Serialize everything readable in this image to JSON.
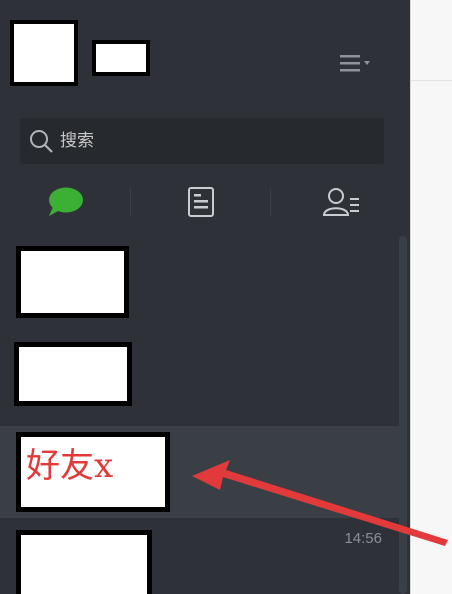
{
  "search": {
    "placeholder": "搜索"
  },
  "icons": {
    "menu": "menu-icon",
    "search": "search-icon",
    "chats": "chat-bubble-icon",
    "contacts_list": "document-list-icon",
    "contacts": "contacts-icon",
    "arrow": "arrow-annotation"
  },
  "colors": {
    "sidebar_bg": "#2e3238",
    "search_bg": "#26292e",
    "active_tab": "#3cb035",
    "annotation_red": "#e23a3a",
    "selected_row": "#3a3f45"
  },
  "chats": [
    {
      "label": "",
      "time": ""
    },
    {
      "label": "",
      "time": ""
    },
    {
      "label": "好友x",
      "time": ""
    },
    {
      "label": "",
      "time": "14:56"
    }
  ]
}
